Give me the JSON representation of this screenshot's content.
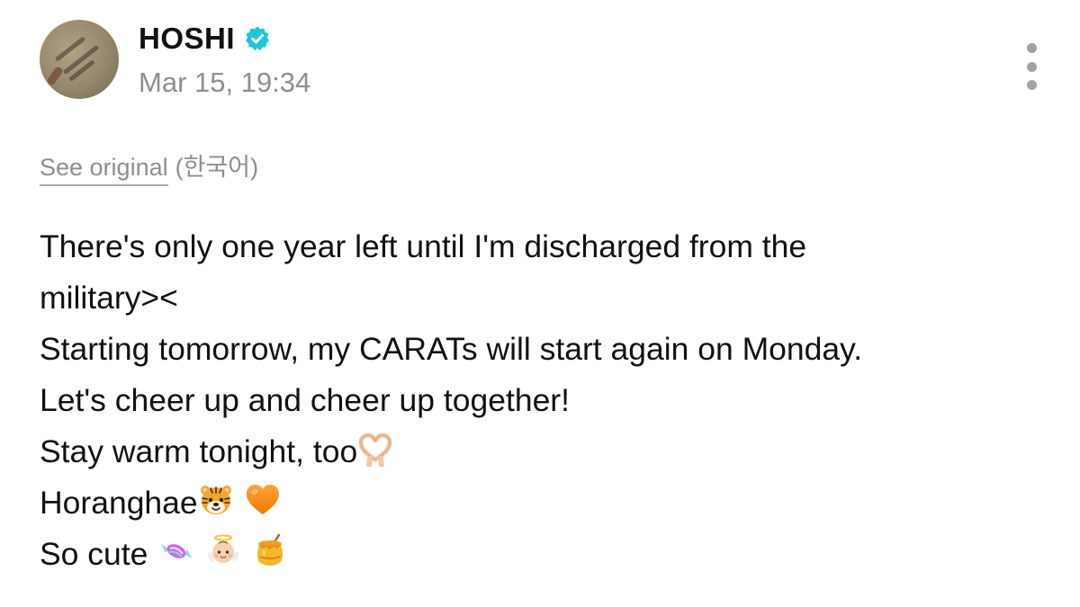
{
  "author": {
    "name": "HOSHI",
    "timestamp": "Mar 15, 19:34",
    "verified": true,
    "accent_color": "#21c4d8"
  },
  "translation": {
    "link_label": "See original",
    "language": "(한국어)"
  },
  "post": {
    "lines": [
      "There's only one year left until I'm discharged from the",
      "military><",
      "Starting tomorrow, my CARATs will start again on Monday.",
      "Let's cheer up and cheer up together!",
      "Stay warm tonight, too",
      "Horanghae",
      "So cute"
    ],
    "emojis": {
      "line_5": [
        "heart-hands-emoji"
      ],
      "line_6": [
        "tiger-face-emoji",
        "orange-heart-emoji"
      ],
      "line_7": [
        "candy-emoji",
        "baby-angel-emoji",
        "honey-pot-emoji"
      ]
    }
  },
  "menu": {
    "icon": "more-vertical-icon"
  }
}
